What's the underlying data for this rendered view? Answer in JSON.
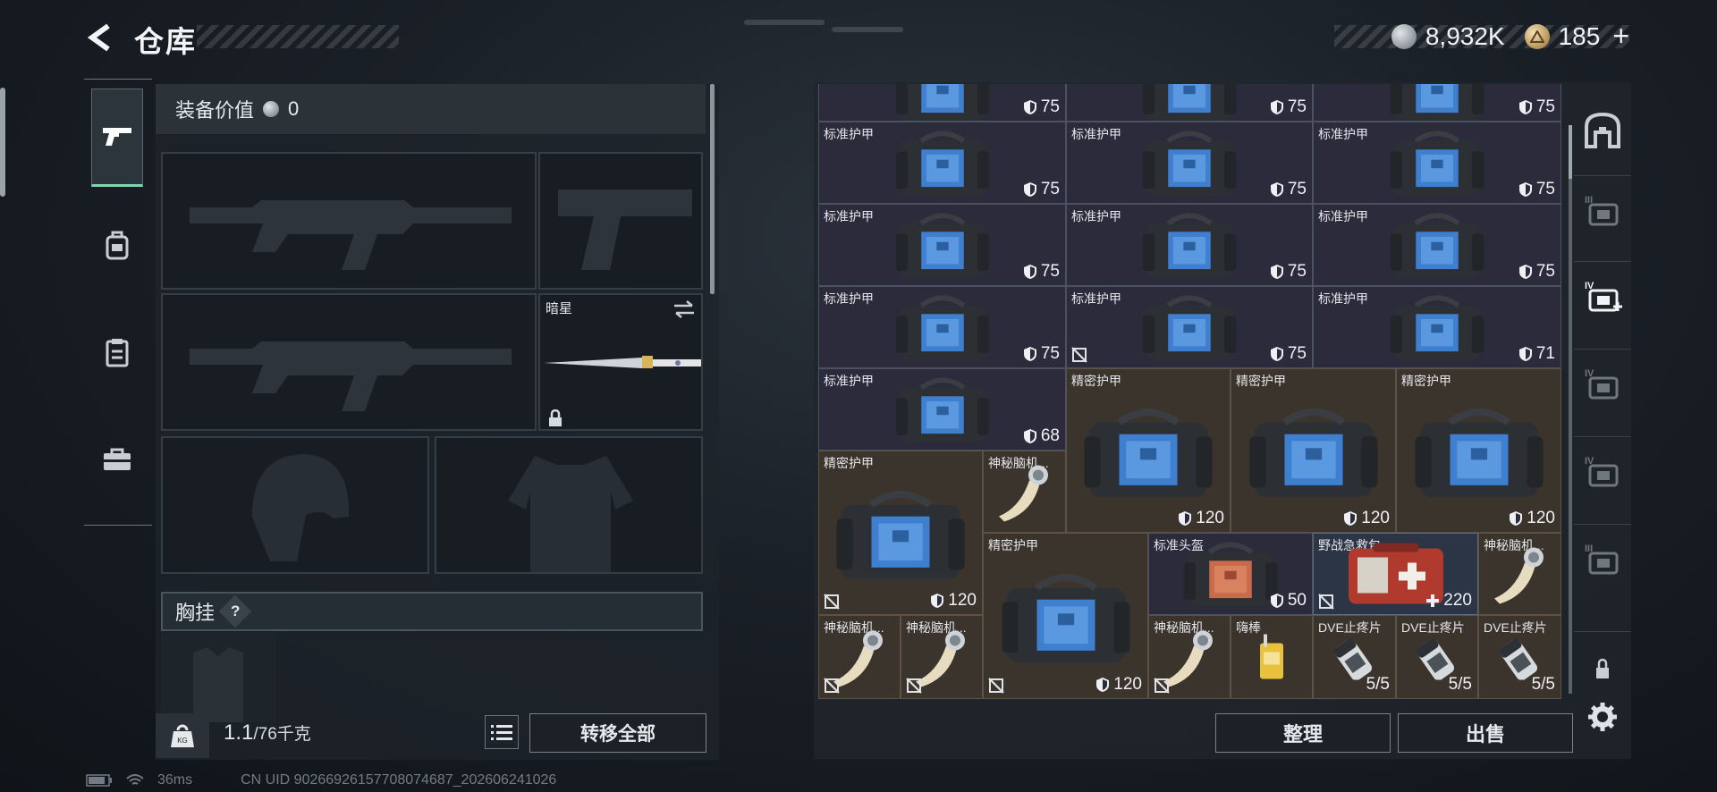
{
  "header": {
    "title": "仓库",
    "silver_amount": "8,932K",
    "gold_amount": "185",
    "plus_label": "+"
  },
  "equipment": {
    "value_label": "装备价值",
    "value": "0",
    "knife_name": "暗星",
    "vest_label": "胸挂",
    "vest_hint": "?"
  },
  "footer": {
    "weight_current": "1.1",
    "weight_max": "/76千克",
    "transfer_all": "转移全部",
    "sort": "整理",
    "sell": "出售"
  },
  "status": {
    "ping": "36ms",
    "uid": "CN UID 9026692615770807468​7_202606241026"
  },
  "inventory": {
    "items": [
      {
        "name": "",
        "value": "75",
        "type": "armor",
        "locked": false
      },
      {
        "name": "",
        "value": "75",
        "type": "armor",
        "locked": false
      },
      {
        "name": "",
        "value": "75",
        "type": "armor",
        "locked": false
      },
      {
        "name": "标准护甲",
        "value": "75",
        "type": "armor",
        "locked": false
      },
      {
        "name": "标准护甲",
        "value": "75",
        "type": "armor",
        "locked": false
      },
      {
        "name": "标准护甲",
        "value": "75",
        "type": "armor",
        "locked": false
      },
      {
        "name": "标准护甲",
        "value": "75",
        "type": "armor",
        "locked": false
      },
      {
        "name": "标准护甲",
        "value": "75",
        "type": "armor",
        "locked": false
      },
      {
        "name": "标准护甲",
        "value": "75",
        "type": "armor",
        "locked": false
      },
      {
        "name": "标准护甲",
        "value": "75",
        "type": "armor",
        "locked": false
      },
      {
        "name": "标准护甲",
        "value": "75",
        "type": "armor",
        "locked": true
      },
      {
        "name": "标准护甲",
        "value": "71",
        "type": "armor",
        "locked": false
      },
      {
        "name": "标准护甲",
        "value": "68",
        "type": "armor",
        "locked": false
      },
      {
        "name": "精密护甲",
        "value": "120",
        "type": "armor",
        "locked": false
      },
      {
        "name": "精密护甲",
        "value": "120",
        "type": "armor",
        "locked": false
      },
      {
        "name": "精密护甲",
        "value": "120",
        "type": "armor",
        "locked": false
      },
      {
        "name": "精密护甲",
        "value": "120",
        "type": "armor",
        "locked": true
      },
      {
        "name": "神秘脑机...",
        "value": "",
        "type": "brain",
        "locked": false
      },
      {
        "name": "精密护甲",
        "value": "120",
        "type": "armor",
        "locked": true
      },
      {
        "name": "标准头盔",
        "value": "50",
        "type": "helmet",
        "locked": false
      },
      {
        "name": "野战急救包",
        "value": "220",
        "type": "medkit",
        "locked": true
      },
      {
        "name": "神秘脑机...",
        "value": "",
        "type": "brain",
        "locked": false
      },
      {
        "name": "神秘脑机...",
        "value": "",
        "type": "brain",
        "locked": true
      },
      {
        "name": "神秘脑机...",
        "value": "",
        "type": "brain",
        "locked": true
      },
      {
        "name": "神秘脑机...",
        "value": "",
        "type": "brain",
        "locked": true
      },
      {
        "name": "嗨棒",
        "value": "",
        "type": "drink",
        "locked": false
      },
      {
        "name": "DVE止疼片",
        "value": "5/5",
        "type": "pill",
        "locked": false
      },
      {
        "name": "DVE止疼片",
        "value": "5/5",
        "type": "pill",
        "locked": false
      },
      {
        "name": "DVE止疼片",
        "value": "5/5",
        "type": "pill",
        "locked": false
      }
    ]
  },
  "right_rail": {
    "tiers": [
      "",
      "III",
      "IV",
      "IV",
      "IV",
      "III",
      ""
    ]
  },
  "colors": {
    "accent_tab": "#7fd7b0",
    "cell_normal": "#2b2b3c",
    "cell_gold": "#3b342d",
    "cell_selected": "#2b3546"
  }
}
